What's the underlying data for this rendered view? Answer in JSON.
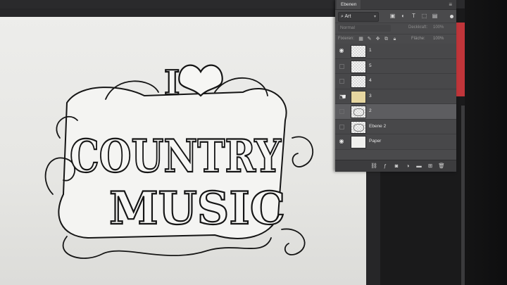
{
  "panel": {
    "tab_label": "Ebenen",
    "menu_icon": "panel-menu-icon",
    "filter": {
      "kind_value": "Art",
      "kind_icon": "search-icon",
      "icons": [
        "pixel-filter-icon",
        "adjustment-filter-icon",
        "type-filter-icon",
        "shape-filter-icon",
        "smart-object-filter-icon"
      ]
    },
    "blend": {
      "mode": "Normal",
      "opacity_label": "Deckkraft:",
      "opacity_value": "100%"
    },
    "lock": {
      "label": "Fixieren:",
      "icons": [
        "lock-transparency-icon",
        "lock-image-icon",
        "lock-position-icon",
        "lock-artboard-icon",
        "lock-all-icon"
      ],
      "fill_label": "Fläche:",
      "fill_value": "100%"
    },
    "layers": [
      {
        "name": "1",
        "visible": true,
        "selected": false,
        "thumb": "transparent"
      },
      {
        "name": "5",
        "visible": false,
        "selected": false,
        "thumb": "transparent"
      },
      {
        "name": "4",
        "visible": false,
        "selected": false,
        "thumb": "transparent"
      },
      {
        "name": "3",
        "visible": false,
        "selected": false,
        "thumb": "gold"
      },
      {
        "name": "2",
        "visible": false,
        "selected": true,
        "thumb": "art"
      },
      {
        "name": "Ebene 2",
        "visible": false,
        "selected": false,
        "thumb": "art"
      },
      {
        "name": "Paper",
        "visible": true,
        "selected": false,
        "thumb": "paper"
      }
    ],
    "footer_icons": [
      "link-layers-icon",
      "fx-icon",
      "add-mask-icon",
      "adjustment-layer-icon",
      "new-group-icon",
      "new-layer-icon",
      "trash-icon"
    ]
  },
  "artwork": {
    "line1": "I",
    "line2": "COUNTRY",
    "line3": "MUSIC"
  },
  "colors": {
    "panel_bg": "#4a4a4c",
    "selected_row": "#5d5d60",
    "paper": "#ececea",
    "ink": "#151515"
  }
}
